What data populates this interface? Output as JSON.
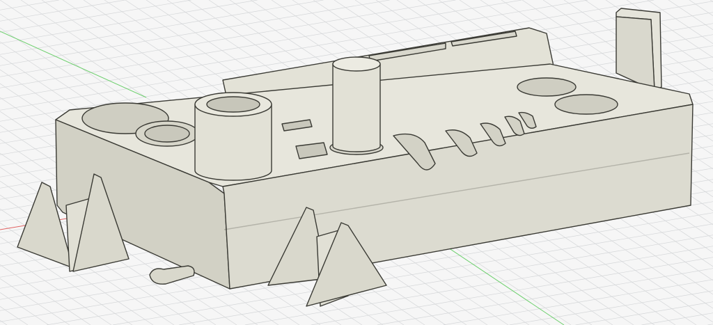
{
  "viewport": {
    "view": "3d-model-viewport",
    "colors": {
      "background": "#f6f6f6",
      "grid": "#d4d6d8",
      "x_axis": "#e06060",
      "y_axis": "#6ccf6c",
      "body_top": "#e7e6dc",
      "body_front": "#dcdbd0",
      "body_side": "#d2d1c5",
      "edge": "#3a3a34"
    }
  }
}
